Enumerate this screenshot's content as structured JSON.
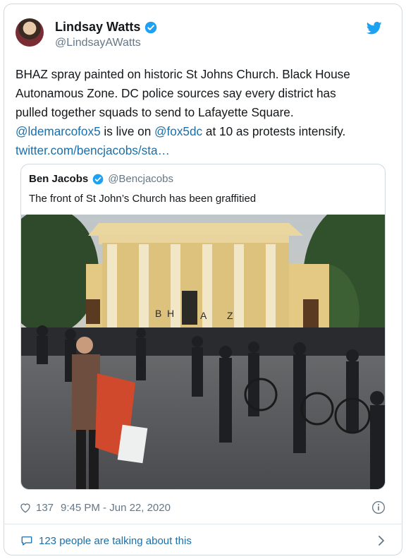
{
  "tweet": {
    "author_name": "Lindsay Watts",
    "author_handle": "@LindsayAWatts",
    "text_line1": "BHAZ spray painted on historic St Johns Church. Black House",
    "text_line2": "Autonamous Zone. DC police sources say every district has",
    "text_line3": "pulled together squads to send to Lafayette Square.",
    "mention1": "@ldemarcofox5",
    "mid_text": " is live on ",
    "mention2": "@fox5dc",
    "end_text": " at 10 as protests intensify.",
    "link": "twitter.com/bencjacobs/sta…"
  },
  "quote": {
    "author_name": "Ben Jacobs",
    "author_handle": "@Bencjacobs",
    "text": "The front of St John’s Church has been graffitied",
    "graffiti_letters": [
      "B",
      "H",
      "A",
      "Z"
    ]
  },
  "footer": {
    "likes": "137",
    "timestamp": "9:45 PM - Jun 22, 2020",
    "talking": "123 people are talking about this"
  },
  "colors": {
    "link": "#1b6fa8",
    "verified": "#1da1f2",
    "twitter_blue": "#1da1f2",
    "muted": "#657786"
  },
  "icons": [
    "verified-badge-icon",
    "twitter-bird-icon",
    "heart-icon",
    "info-icon",
    "comment-bubble-icon",
    "chevron-right-icon"
  ]
}
